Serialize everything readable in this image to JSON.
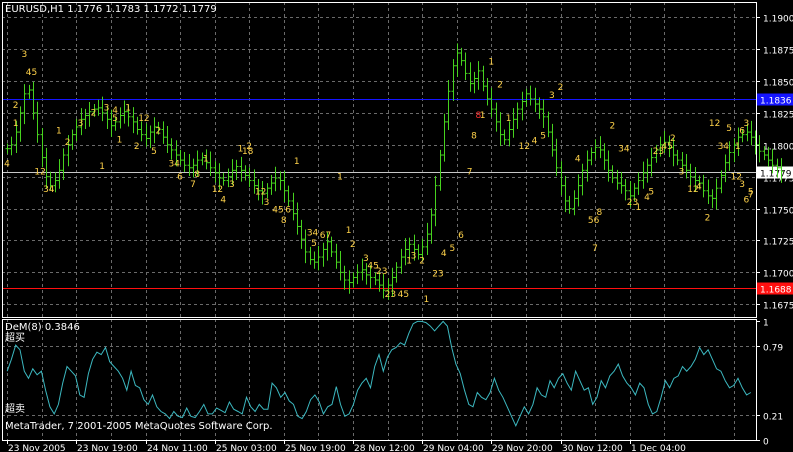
{
  "chart_data": {
    "type": "candlestick",
    "main": {
      "title": "EURUSD,H1  1.1776 1.1783 1.1772 1.1779",
      "y_ticks": [
        "1.1900",
        "1.1875",
        "1.1850",
        "1.1825",
        "1.1800",
        "1.1775",
        "1.1750",
        "1.1725",
        "1.1700",
        "1.1675"
      ],
      "y_tick_values": [
        1.19,
        1.1875,
        1.185,
        1.1825,
        1.18,
        1.1775,
        1.175,
        1.1725,
        1.17,
        1.1675
      ],
      "ylim": [
        1.1665,
        1.1912
      ],
      "levels": [
        {
          "name": "blue-level",
          "value": 1.1836,
          "label": "1.1836",
          "color": "#1515ff"
        },
        {
          "name": "current-price",
          "value": 1.1779,
          "label": "1.1779",
          "color": "#c8c8c8"
        },
        {
          "name": "red-level",
          "value": 1.1688,
          "label": "1.1688",
          "color": "#ff1010"
        }
      ]
    },
    "indicator": {
      "title": "DeM(8) 0.3846",
      "overbought_label": "超买",
      "oversold_label": "超卖",
      "copyright": "MetaTrader, 7 2001-2005 MetaQuotes Software Corp.",
      "y_ticks": [
        "1",
        "0.79",
        "0.21",
        "0"
      ],
      "y_tick_values": [
        1,
        0.79,
        0.21,
        0
      ],
      "ylim": [
        0,
        1.02
      ],
      "line_color": "#3cb8c0",
      "values": [
        0.58,
        0.68,
        0.8,
        0.76,
        0.58,
        0.52,
        0.6,
        0.55,
        0.58,
        0.42,
        0.28,
        0.22,
        0.3,
        0.48,
        0.62,
        0.58,
        0.54,
        0.38,
        0.36,
        0.56,
        0.68,
        0.74,
        0.72,
        0.78,
        0.66,
        0.62,
        0.58,
        0.52,
        0.42,
        0.58,
        0.46,
        0.44,
        0.34,
        0.3,
        0.38,
        0.28,
        0.24,
        0.22,
        0.18,
        0.24,
        0.2,
        0.19,
        0.27,
        0.2,
        0.19,
        0.24,
        0.3,
        0.22,
        0.22,
        0.27,
        0.25,
        0.23,
        0.32,
        0.26,
        0.24,
        0.22,
        0.36,
        0.28,
        0.24,
        0.3,
        0.26,
        0.26,
        0.48,
        0.44,
        0.36,
        0.4,
        0.33,
        0.3,
        0.2,
        0.18,
        0.24,
        0.34,
        0.38,
        0.32,
        0.22,
        0.28,
        0.3,
        0.45,
        0.3,
        0.2,
        0.22,
        0.3,
        0.42,
        0.48,
        0.52,
        0.44,
        0.62,
        0.72,
        0.58,
        0.7,
        0.76,
        0.78,
        0.82,
        0.8,
        0.9,
        0.98,
        1.0,
        1.0,
        0.99,
        0.96,
        0.92,
        0.96,
        1.0,
        0.96,
        0.78,
        0.64,
        0.56,
        0.42,
        0.3,
        0.28,
        0.4,
        0.36,
        0.34,
        0.4,
        0.52,
        0.42,
        0.36,
        0.28,
        0.2,
        0.12,
        0.2,
        0.28,
        0.22,
        0.3,
        0.44,
        0.38,
        0.36,
        0.5,
        0.44,
        0.52,
        0.56,
        0.48,
        0.42,
        0.58,
        0.5,
        0.42,
        0.44,
        0.3,
        0.36,
        0.5,
        0.44,
        0.54,
        0.58,
        0.64,
        0.54,
        0.48,
        0.44,
        0.38,
        0.48,
        0.44,
        0.3,
        0.22,
        0.24,
        0.36,
        0.5,
        0.44,
        0.52,
        0.54,
        0.62,
        0.58,
        0.62,
        0.68,
        0.78,
        0.72,
        0.76,
        0.68,
        0.6,
        0.58,
        0.5,
        0.44,
        0.46,
        0.52,
        0.44,
        0.38,
        0.4
      ]
    },
    "x_tick_labels": [
      "23 Nov 2005",
      "23 Nov 19:00",
      "24 Nov 11:00",
      "25 Nov 03:00",
      "25 Nov 19:00",
      "28 Nov 12:00",
      "29 Nov 04:00",
      "29 Nov 20:00",
      "30 Nov 12:00",
      "1 Dec 04:00"
    ],
    "x_tick_bars": [
      0,
      16,
      32,
      48,
      64,
      80,
      96,
      112,
      128,
      144
    ],
    "bar_count": 173,
    "closes": [
      1.1797,
      1.18,
      1.181,
      1.1825,
      1.184,
      1.1843,
      1.1825,
      1.1808,
      1.179,
      1.1775,
      1.1768,
      1.1772,
      1.178,
      1.1792,
      1.18,
      1.1808,
      1.1814,
      1.182,
      1.1823,
      1.1826,
      1.1828,
      1.1829,
      1.1825,
      1.182,
      1.1815,
      1.1818,
      1.1823,
      1.1826,
      1.1822,
      1.1818,
      1.1812,
      1.1808,
      1.1805,
      1.181,
      1.1814,
      1.1812,
      1.1806,
      1.18,
      1.1796,
      1.1792,
      1.1788,
      1.1784,
      1.1782,
      1.1784,
      1.1788,
      1.179,
      1.1786,
      1.1782,
      1.1778,
      1.1774,
      1.1772,
      1.1775,
      1.178,
      1.1783,
      1.178,
      1.1776,
      1.1772,
      1.1768,
      1.1764,
      1.1762,
      1.1766,
      1.177,
      1.1774,
      1.1772,
      1.1764,
      1.1756,
      1.1746,
      1.1736,
      1.1726,
      1.1716,
      1.171,
      1.1708,
      1.1712,
      1.1718,
      1.1724,
      1.1716,
      1.1708,
      1.17,
      1.1694,
      1.1692,
      1.1696,
      1.17,
      1.1702,
      1.1698,
      1.1696,
      1.1694,
      1.169,
      1.1686,
      1.169,
      1.1696,
      1.1704,
      1.1712,
      1.1718,
      1.1722,
      1.1718,
      1.1714,
      1.172,
      1.173,
      1.1745,
      1.1768,
      1.1792,
      1.1818,
      1.1842,
      1.1862,
      1.1872,
      1.1866,
      1.1856,
      1.1848,
      1.1852,
      1.1858,
      1.1846,
      1.1836,
      1.1828,
      1.1818,
      1.1808,
      1.1804,
      1.1812,
      1.182,
      1.1828,
      1.1834,
      1.184,
      1.1836,
      1.1832,
      1.1828,
      1.1822,
      1.181,
      1.1796,
      1.1782,
      1.1768,
      1.1756,
      1.175,
      1.1758,
      1.1768,
      1.178,
      1.1788,
      1.1794,
      1.1798,
      1.1796,
      1.1788,
      1.178,
      1.1774,
      1.177,
      1.1768,
      1.1764,
      1.176,
      1.1766,
      1.1772,
      1.1778,
      1.1784,
      1.179,
      1.1796,
      1.18,
      1.1802,
      1.1798,
      1.1792,
      1.1788,
      1.1784,
      1.178,
      1.1775,
      1.1772,
      1.177,
      1.1764,
      1.176,
      1.1758,
      1.1766,
      1.1776,
      1.1786,
      1.1794,
      1.18,
      1.1806,
      1.1808,
      1.181,
      1.1806,
      1.18,
      1.1795,
      1.1792,
      1.1788,
      1.1784,
      1.1782,
      1.1779
    ],
    "wave_labels": [
      {
        "bar": 0,
        "price": 1.1786,
        "text": "4"
      },
      {
        "bar": 2,
        "price": 1.1818,
        "text": "1"
      },
      {
        "bar": 2,
        "price": 1.1832,
        "text": "2"
      },
      {
        "bar": 5,
        "price": 1.1858,
        "text": "45"
      },
      {
        "bar": 4,
        "price": 1.1872,
        "text": "3"
      },
      {
        "bar": 7,
        "price": 1.178,
        "text": "12"
      },
      {
        "bar": 9,
        "price": 1.1766,
        "text": "34"
      },
      {
        "bar": 12,
        "price": 1.1812,
        "text": "1"
      },
      {
        "bar": 14,
        "price": 1.1803,
        "text": "2"
      },
      {
        "bar": 17,
        "price": 1.1818,
        "text": "3"
      },
      {
        "bar": 20,
        "price": 1.1826,
        "text": "2"
      },
      {
        "bar": 23,
        "price": 1.183,
        "text": "3"
      },
      {
        "bar": 25,
        "price": 1.1828,
        "text": "4"
      },
      {
        "bar": 25,
        "price": 1.1822,
        "text": "5"
      },
      {
        "bar": 22,
        "price": 1.1784,
        "text": "1"
      },
      {
        "bar": 26,
        "price": 1.1805,
        "text": "1"
      },
      {
        "bar": 30,
        "price": 1.18,
        "text": "2"
      },
      {
        "bar": 28,
        "price": 1.183,
        "text": "1"
      },
      {
        "bar": 31,
        "price": 1.1822,
        "text": "12"
      },
      {
        "bar": 35,
        "price": 1.1812,
        "text": "2"
      },
      {
        "bar": 34,
        "price": 1.1796,
        "text": "5"
      },
      {
        "bar": 38,
        "price": 1.1786,
        "text": "34"
      },
      {
        "bar": 40,
        "price": 1.1776,
        "text": "6"
      },
      {
        "bar": 43,
        "price": 1.177,
        "text": "7"
      },
      {
        "bar": 44,
        "price": 1.1778,
        "text": "8"
      },
      {
        "bar": 46,
        "price": 1.179,
        "text": "1"
      },
      {
        "bar": 48,
        "price": 1.1766,
        "text": "12"
      },
      {
        "bar": 50,
        "price": 1.1758,
        "text": "4"
      },
      {
        "bar": 52,
        "price": 1.177,
        "text": "3"
      },
      {
        "bar": 54,
        "price": 1.1798,
        "text": "1"
      },
      {
        "bar": 56,
        "price": 1.18,
        "text": "2"
      },
      {
        "bar": 55,
        "price": 1.1796,
        "text": "18"
      },
      {
        "bar": 58,
        "price": 1.1764,
        "text": "12"
      },
      {
        "bar": 60,
        "price": 1.1756,
        "text": "3"
      },
      {
        "bar": 62,
        "price": 1.175,
        "text": "45"
      },
      {
        "bar": 65,
        "price": 1.175,
        "text": "6"
      },
      {
        "bar": 64,
        "price": 1.1742,
        "text": "8"
      },
      {
        "bar": 67,
        "price": 1.1788,
        "text": "1"
      },
      {
        "bar": 70,
        "price": 1.1732,
        "text": "34"
      },
      {
        "bar": 71,
        "price": 1.1724,
        "text": "5"
      },
      {
        "bar": 73,
        "price": 1.173,
        "text": "67"
      },
      {
        "bar": 77,
        "price": 1.1776,
        "text": "1"
      },
      {
        "bar": 80,
        "price": 1.1723,
        "text": "2"
      },
      {
        "bar": 83,
        "price": 1.1712,
        "text": "3"
      },
      {
        "bar": 84,
        "price": 1.1706,
        "text": "45"
      },
      {
        "bar": 79,
        "price": 1.1734,
        "text": "1"
      },
      {
        "bar": 86,
        "price": 1.1702,
        "text": "23"
      },
      {
        "bar": 88,
        "price": 1.1684,
        "text": "23"
      },
      {
        "bar": 91,
        "price": 1.1684,
        "text": "45"
      },
      {
        "bar": 93,
        "price": 1.171,
        "text": "1"
      },
      {
        "bar": 96,
        "price": 1.171,
        "text": "2"
      },
      {
        "bar": 94,
        "price": 1.1714,
        "text": "3"
      },
      {
        "bar": 99,
        "price": 1.17,
        "text": "23"
      },
      {
        "bar": 101,
        "price": 1.1716,
        "text": "4"
      },
      {
        "bar": 103,
        "price": 1.172,
        "text": "5"
      },
      {
        "bar": 105,
        "price": 1.173,
        "text": "6"
      },
      {
        "bar": 107,
        "price": 1.178,
        "text": "7"
      },
      {
        "bar": 97,
        "price": 1.168,
        "text": "1"
      },
      {
        "bar": 108,
        "price": 1.1808,
        "text": "8"
      },
      {
        "bar": 112,
        "price": 1.1866,
        "text": "1"
      },
      {
        "bar": 114,
        "price": 1.1848,
        "text": "2"
      },
      {
        "bar": 116,
        "price": 1.1822,
        "text": "1"
      },
      {
        "bar": 119,
        "price": 1.18,
        "text": "12"
      },
      {
        "bar": 122,
        "price": 1.1804,
        "text": "4"
      },
      {
        "bar": 124,
        "price": 1.1808,
        "text": "5"
      },
      {
        "bar": 126,
        "price": 1.184,
        "text": "3"
      },
      {
        "bar": 128,
        "price": 1.1846,
        "text": "2"
      },
      {
        "bar": 132,
        "price": 1.179,
        "text": "4"
      },
      {
        "bar": 135,
        "price": 1.1742,
        "text": "56"
      },
      {
        "bar": 137,
        "price": 1.1748,
        "text": "8"
      },
      {
        "bar": 136,
        "price": 1.172,
        "text": "7"
      },
      {
        "bar": 140,
        "price": 1.1816,
        "text": "2"
      },
      {
        "bar": 142,
        "price": 1.1798,
        "text": "34"
      },
      {
        "bar": 144,
        "price": 1.1756,
        "text": "23"
      },
      {
        "bar": 146,
        "price": 1.1752,
        "text": "1"
      },
      {
        "bar": 148,
        "price": 1.176,
        "text": "4"
      },
      {
        "bar": 149,
        "price": 1.1764,
        "text": "5"
      },
      {
        "bar": 150,
        "price": 1.1796,
        "text": "23"
      },
      {
        "bar": 152,
        "price": 1.18,
        "text": "45"
      },
      {
        "bar": 154,
        "price": 1.1806,
        "text": "2"
      },
      {
        "bar": 156,
        "price": 1.178,
        "text": "3"
      },
      {
        "bar": 158,
        "price": 1.1766,
        "text": "12"
      },
      {
        "bar": 160,
        "price": 1.1768,
        "text": "4"
      },
      {
        "bar": 162,
        "price": 1.1744,
        "text": "2"
      },
      {
        "bar": 163,
        "price": 1.1818,
        "text": "12"
      },
      {
        "bar": 165,
        "price": 1.18,
        "text": "34"
      },
      {
        "bar": 167,
        "price": 1.1814,
        "text": "5"
      },
      {
        "bar": 169,
        "price": 1.18,
        "text": "1"
      },
      {
        "bar": 170,
        "price": 1.1812,
        "text": "6"
      },
      {
        "bar": 171,
        "price": 1.1818,
        "text": "3"
      },
      {
        "bar": 168,
        "price": 1.1776,
        "text": "12"
      },
      {
        "bar": 170,
        "price": 1.177,
        "text": "3"
      },
      {
        "bar": 172,
        "price": 1.1764,
        "text": "5"
      },
      {
        "bar": 171,
        "price": 1.1758,
        "text": "6"
      },
      {
        "bar": 172,
        "price": 1.1762,
        "text": "7"
      }
    ],
    "special_labels": [
      {
        "bar": 109,
        "price": 1.1824,
        "text": "8",
        "color": "#ff3030"
      },
      {
        "bar": 110,
        "price": 1.1824,
        "text": "1",
        "color": "#ffd24a"
      }
    ]
  },
  "colors": {
    "bg": "#000000",
    "grid": "#6a6a6a",
    "border": "#ffffff",
    "candle": "#46d21e",
    "label": "#ffd24a",
    "text": "#ffffff"
  }
}
